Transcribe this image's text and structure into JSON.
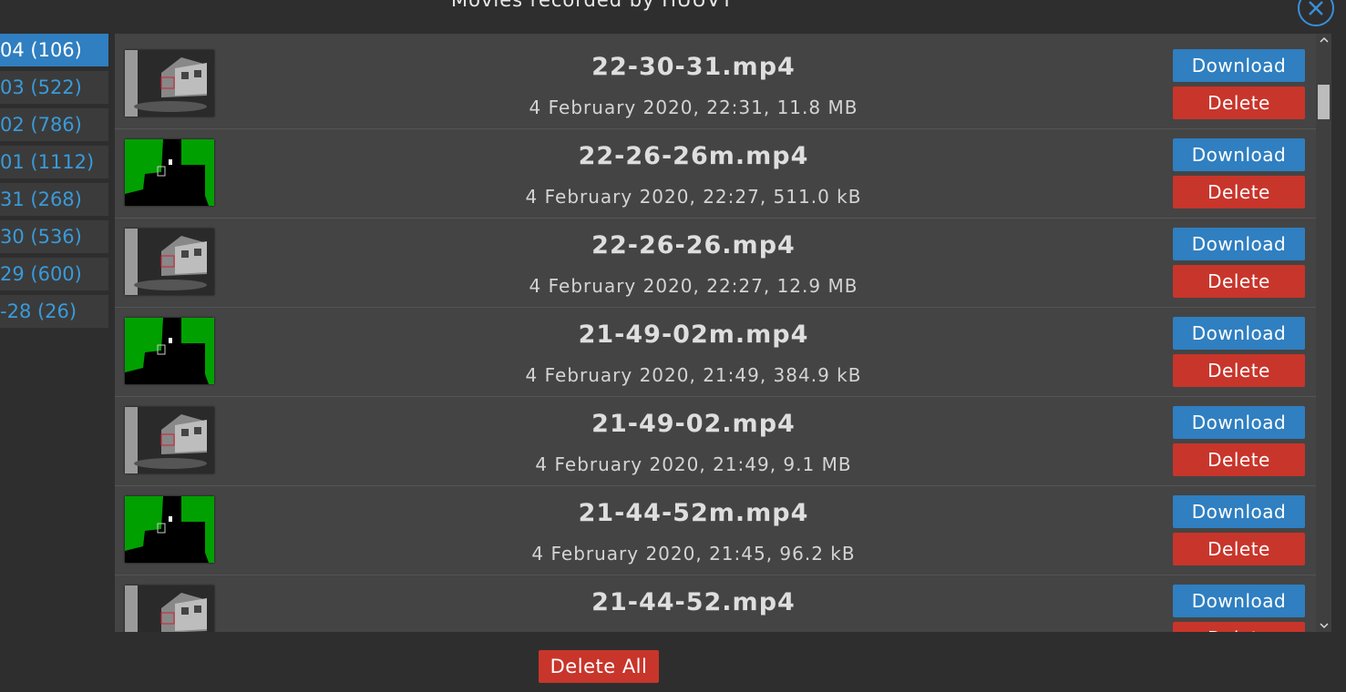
{
  "dialog": {
    "title": "Movies recorded by HUUVT",
    "close_icon": "close-circle-icon",
    "accent_color": "#2f7fc1",
    "danger_color": "#c8352b"
  },
  "sidebar": {
    "items": [
      {
        "label": "04 (106)",
        "active": true
      },
      {
        "label": "03 (522)",
        "active": false
      },
      {
        "label": "02 (786)",
        "active": false
      },
      {
        "label": "01 (1112)",
        "active": false
      },
      {
        "label": "31 (268)",
        "active": false
      },
      {
        "label": "30 (536)",
        "active": false
      },
      {
        "label": "29 (600)",
        "active": false
      },
      {
        "label": "-28 (26)",
        "active": false
      }
    ]
  },
  "movies": [
    {
      "name": "22-30-31.mp4",
      "meta": "4 February 2020, 22:31, 11.8 MB",
      "thumb": "night-camera-preview",
      "download_label": "Download",
      "delete_label": "Delete"
    },
    {
      "name": "22-26-26m.mp4",
      "meta": "4 February 2020, 22:27, 511.0 kB",
      "thumb": "motion-mask-preview",
      "download_label": "Download",
      "delete_label": "Delete"
    },
    {
      "name": "22-26-26.mp4",
      "meta": "4 February 2020, 22:27, 12.9 MB",
      "thumb": "night-camera-preview",
      "download_label": "Download",
      "delete_label": "Delete"
    },
    {
      "name": "21-49-02m.mp4",
      "meta": "4 February 2020, 21:49, 384.9 kB",
      "thumb": "motion-mask-preview",
      "download_label": "Download",
      "delete_label": "Delete"
    },
    {
      "name": "21-49-02.mp4",
      "meta": "4 February 2020, 21:49, 9.1 MB",
      "thumb": "night-camera-preview",
      "download_label": "Download",
      "delete_label": "Delete"
    },
    {
      "name": "21-44-52m.mp4",
      "meta": "4 February 2020, 21:45, 96.2 kB",
      "thumb": "motion-mask-preview",
      "download_label": "Download",
      "delete_label": "Delete"
    },
    {
      "name": "21-44-52.mp4",
      "meta": "",
      "thumb": "night-camera-preview",
      "download_label": "Download",
      "delete_label": "Delete"
    }
  ],
  "footer": {
    "delete_all_label": "Delete All"
  }
}
